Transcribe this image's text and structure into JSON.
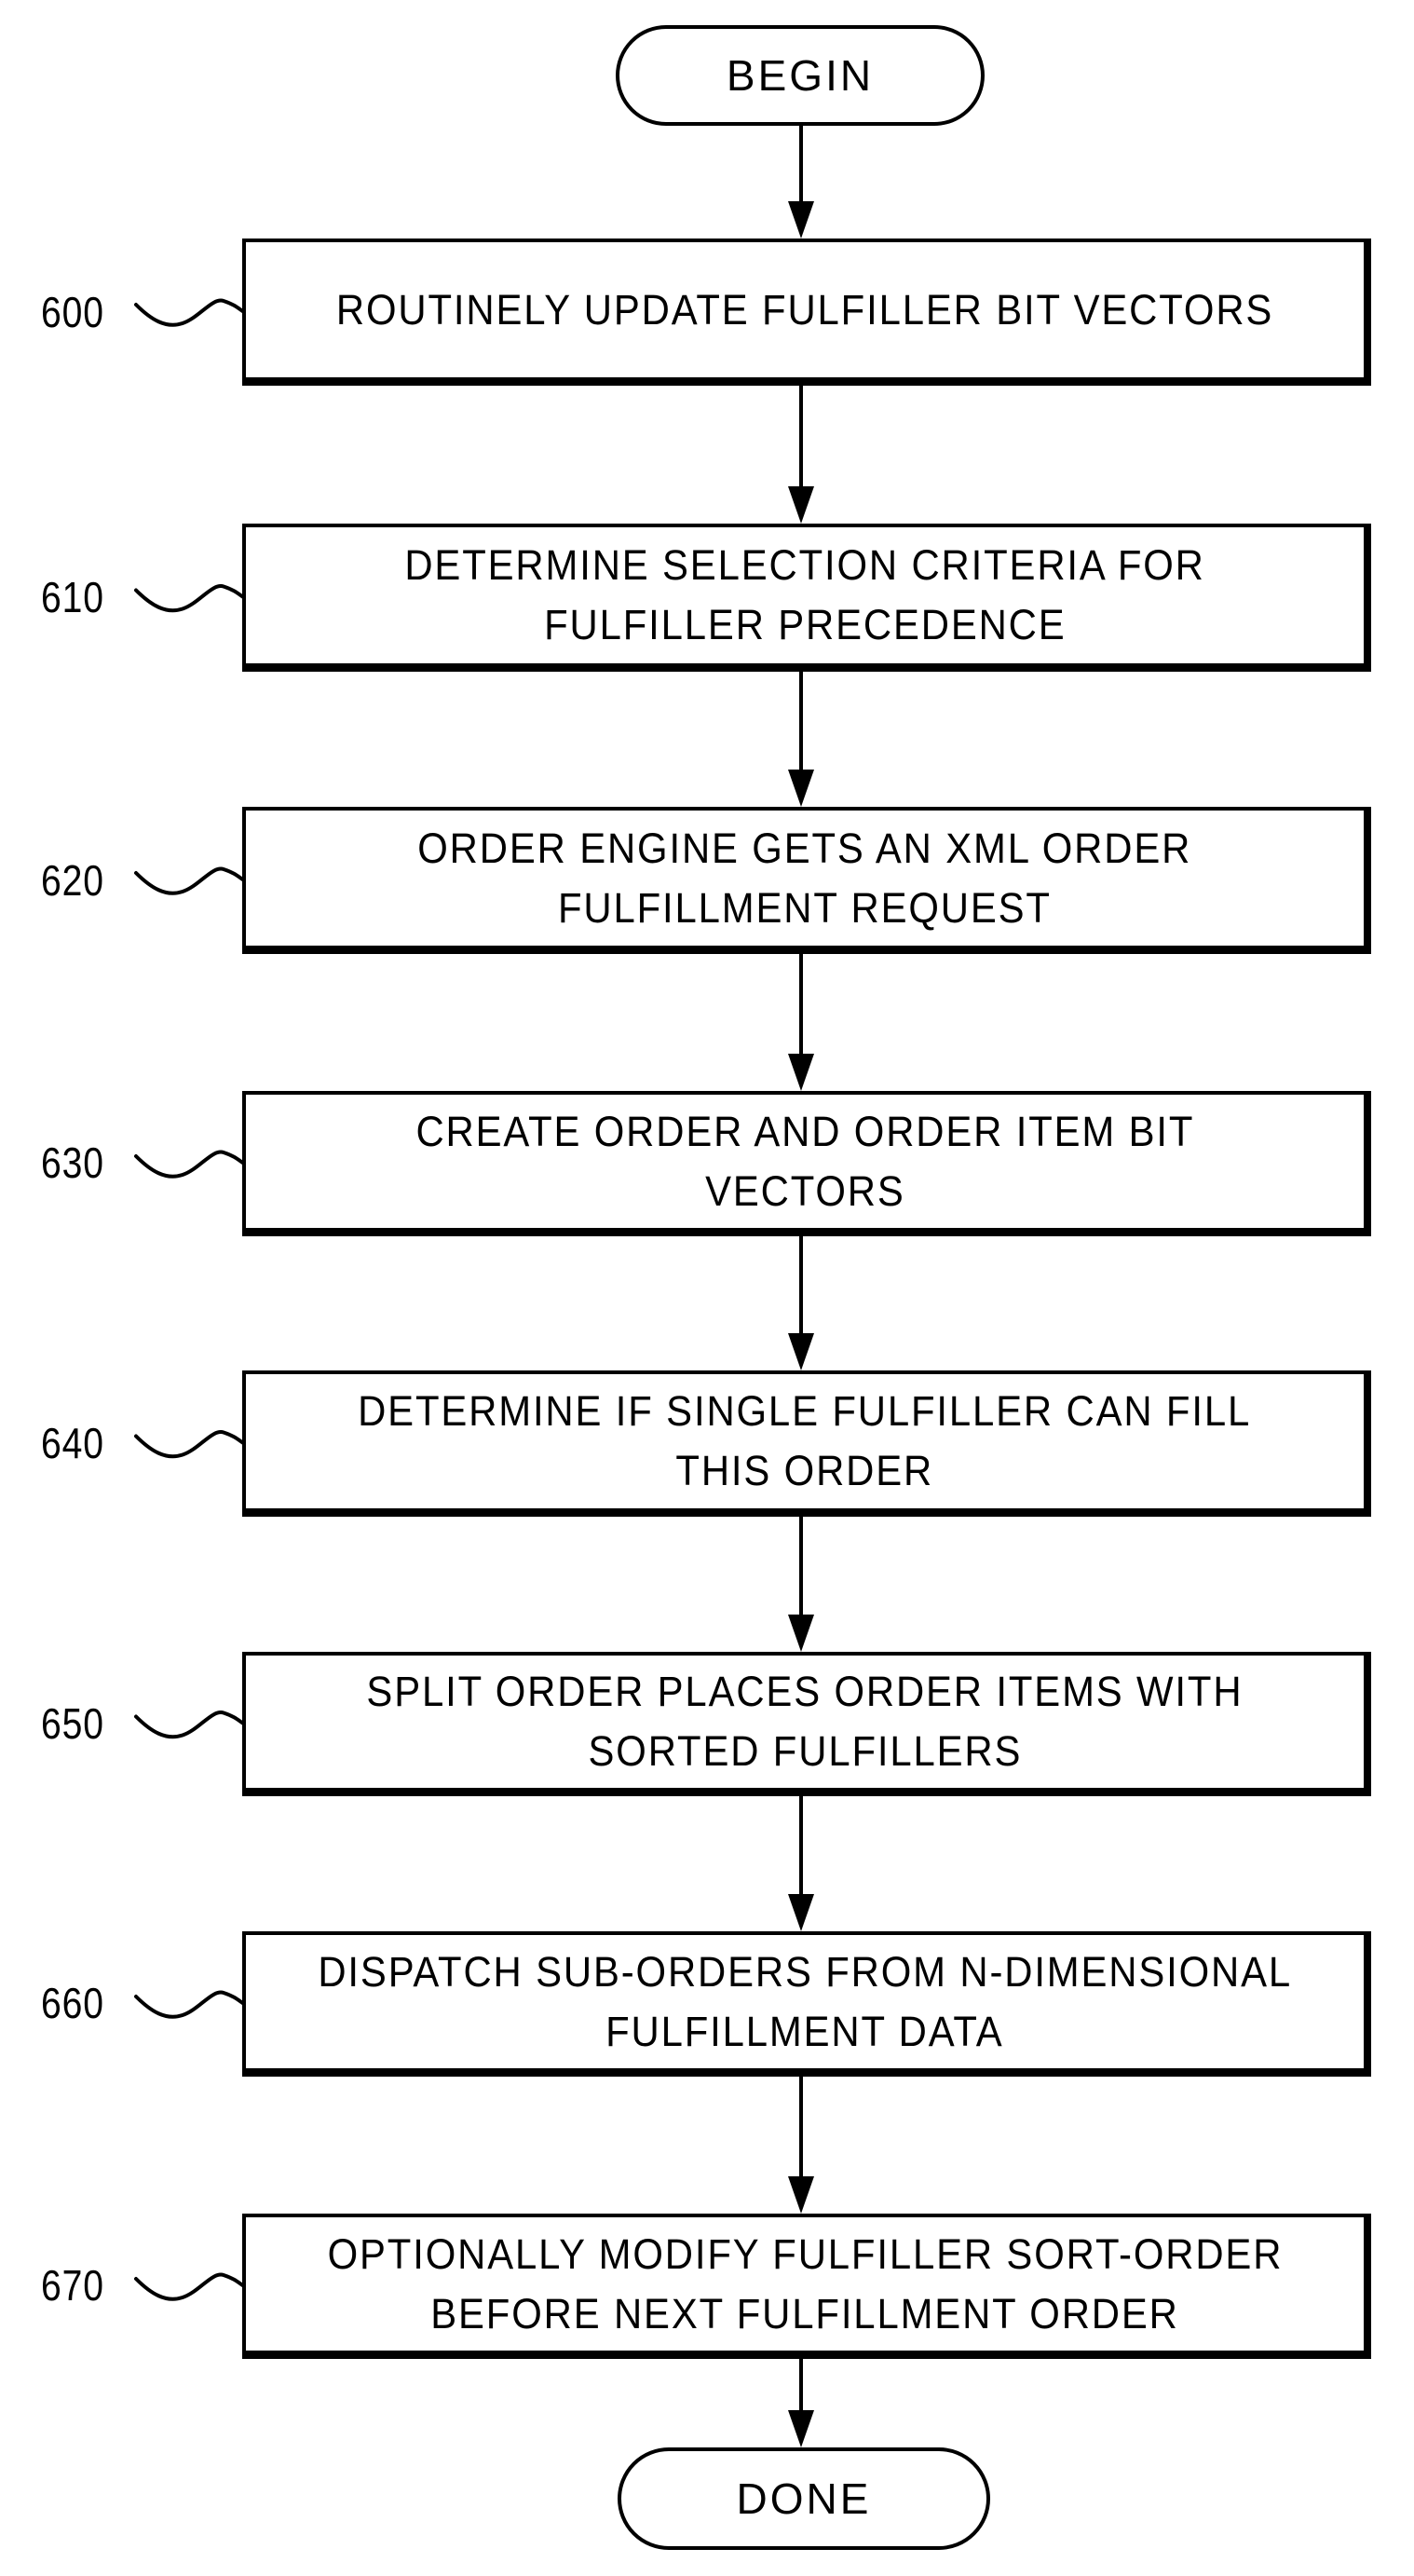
{
  "diagram": {
    "type": "flowchart",
    "start": {
      "label": "BEGIN"
    },
    "end": {
      "label": "DONE"
    },
    "steps": [
      {
        "ref": "600",
        "lines": [
          "ROUTINELY UPDATE FULFILLER BIT VECTORS"
        ]
      },
      {
        "ref": "610",
        "lines": [
          "DETERMINE SELECTION CRITERIA FOR",
          "FULFILLER PRECEDENCE"
        ]
      },
      {
        "ref": "620",
        "lines": [
          "ORDER ENGINE GETS AN XML ORDER",
          "FULFILLMENT REQUEST"
        ]
      },
      {
        "ref": "630",
        "lines": [
          "CREATE ORDER AND ORDER ITEM BIT",
          "VECTORS"
        ]
      },
      {
        "ref": "640",
        "lines": [
          "DETERMINE IF SINGLE FULFILLER CAN FILL",
          "THIS ORDER"
        ]
      },
      {
        "ref": "650",
        "lines": [
          "SPLIT ORDER PLACES ORDER ITEMS WITH",
          "SORTED FULFILLERS"
        ]
      },
      {
        "ref": "660",
        "lines": [
          "DISPATCH SUB-ORDERS FROM N-DIMENSIONAL",
          "FULFILLMENT DATA"
        ]
      },
      {
        "ref": "670",
        "lines": [
          "OPTIONALLY MODIFY FULFILLER SORT-ORDER",
          "BEFORE NEXT FULFILLMENT ORDER"
        ]
      }
    ],
    "colors": {
      "ink": "#000000",
      "background": "#ffffff"
    }
  }
}
